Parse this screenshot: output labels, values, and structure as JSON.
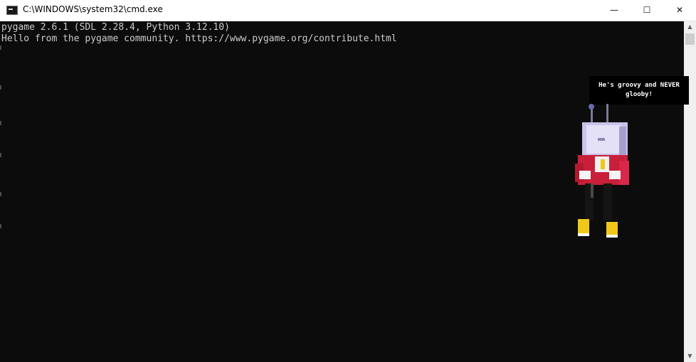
{
  "window": {
    "title": "C:\\WINDOWS\\system32\\cmd.exe",
    "icon": "cmd-icon",
    "controls": {
      "minimize": "—",
      "maximize": "☐",
      "close": "✕"
    }
  },
  "console": {
    "lines": [
      "pygame 2.6.1 (SDL 2.28.4, Python 3.12.10)",
      "Hello from the pygame community. https://www.pygame.org/contribute.html"
    ]
  },
  "character": {
    "speech_line1": "He's groovy and NEVER",
    "speech_line2": "glooby!"
  },
  "colors": {
    "console_background": "#0c0c0c",
    "console_text": "#cccccc",
    "coat": "#c8203a",
    "head": "#c9c4e8",
    "boots": "#f0c81a"
  }
}
